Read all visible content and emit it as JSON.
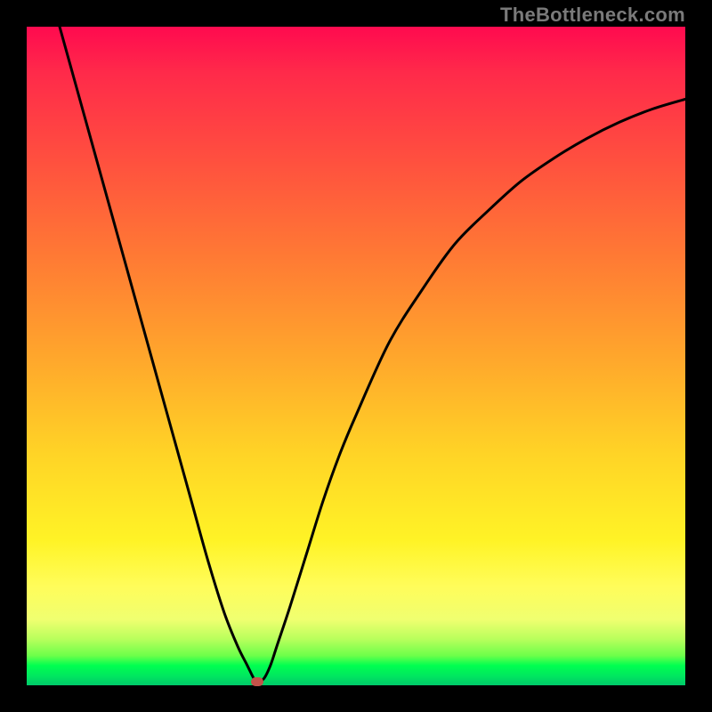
{
  "watermark": "TheBottleneck.com",
  "colors": {
    "curve": "#000000",
    "marker": "#c4534a",
    "frame_bg": "#000000"
  },
  "chart_data": {
    "type": "line",
    "title": "",
    "xlabel": "",
    "ylabel": "",
    "xlim": [
      0,
      100
    ],
    "ylim": [
      0,
      100
    ],
    "grid": false,
    "legend": false,
    "series": [
      {
        "name": "curve",
        "x": [
          5,
          7.5,
          10,
          12.5,
          15,
          17.5,
          20,
          22.5,
          25,
          27.5,
          30,
          32,
          33.5,
          34.5,
          35,
          36,
          37,
          38,
          40,
          42.5,
          45,
          47.5,
          50,
          55,
          60,
          65,
          70,
          75,
          80,
          85,
          90,
          95,
          100
        ],
        "values": [
          100,
          91,
          82,
          73,
          64,
          55,
          46,
          37,
          28,
          19,
          11,
          6,
          3,
          1,
          0.5,
          1,
          3,
          6,
          12,
          20,
          28,
          35,
          41,
          52,
          60,
          67,
          72,
          76.5,
          80,
          83,
          85.5,
          87.5,
          89
        ]
      }
    ],
    "marker": {
      "x": 35,
      "y": 0.5
    },
    "gradient_background": {
      "top": "#ff0a4f",
      "mid": "#fff326",
      "bottom": "#00c96a"
    }
  }
}
